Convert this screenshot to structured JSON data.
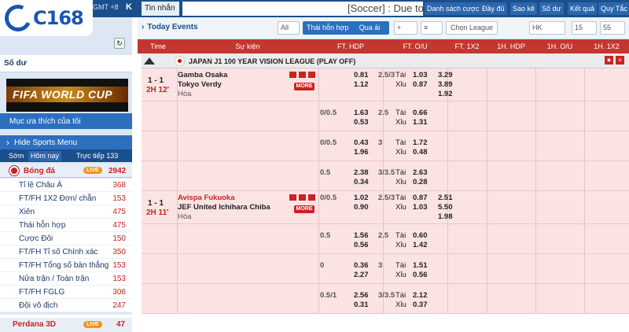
{
  "brand": {
    "name": "C168"
  },
  "topbar": {
    "gmt": "GMT +8",
    "k_label": "K",
    "msg_tab": "Tin nhắn",
    "ticker": "[Soccer] : Due to",
    "buttons": [
      "Danh sách cược",
      "Đầy đủ",
      "Sao kê",
      "Số dư",
      "Kết quả",
      "Quy Tắc"
    ]
  },
  "sidebar": {
    "balance_label": "Số dư",
    "banner_text": "FIFA WORLD CUP",
    "favorites": "Mục ưa thích của tôi",
    "hide_sports": "Hide Sports Menu",
    "tabs": [
      "Sớm",
      "Hôm nay",
      "Trực tiếp 133"
    ],
    "sport": {
      "name": "Bóng đá",
      "live": "LIVE",
      "count": "2942"
    },
    "menu": [
      {
        "label": "Tỉ lệ Châu Á",
        "count": "368"
      },
      {
        "label": "FT/FH 1X2 Đơn/ chẵn",
        "count": "153"
      },
      {
        "label": "Xiên",
        "count": "475"
      },
      {
        "label": "Thái hỗn hợp",
        "count": "475"
      },
      {
        "label": "Cược Đôi",
        "count": "150"
      },
      {
        "label": "FT/FH Tỉ số Chính xác",
        "count": "350"
      },
      {
        "label": "FT/FH Tổng số bàn thắng",
        "count": "153"
      },
      {
        "label": "Nửa trận / Toàn trận",
        "count": "153"
      },
      {
        "label": "FT/FH FGLG",
        "count": "306"
      },
      {
        "label": "Đội vô địch",
        "count": "247"
      }
    ],
    "next_sport": {
      "name": "Perdana 3D",
      "live": "LIVE",
      "count": "47"
    }
  },
  "main": {
    "title": "Today Events",
    "filters": {
      "all": "All",
      "mix": "Thái hỗn hợp",
      "qua_ai": "Qua ải",
      "plus": "+",
      "list": "≡",
      "choose_league": "Chọn League",
      "odds_type": "HK",
      "refresh_count": "15",
      "count2": "55"
    },
    "columns": [
      "Time",
      "Sự kiện",
      "FT. HDP",
      "FT. O/U",
      "FT. 1X2",
      "1H. HDP",
      "1H. O/U",
      "1H. 1X2"
    ],
    "league": "JAPAN J1 100 YEAR VISION LEAGUE (PLAY OFF)",
    "more_label": "MORE",
    "matches": [
      {
        "score": "1 - 1",
        "time": "2H 12'",
        "home": "Gamba Osaka",
        "away": "Tokyo Verdy",
        "draw": "Hòa",
        "home_color": "#222",
        "lines": [
          {
            "hdp_line": "",
            "hdp_h": "0.81",
            "hdp_a": "1.12",
            "ou_line": "2.5/3",
            "ou_over_lbl": "Tài",
            "ou_over": "1.03",
            "ou_under_lbl": "Xỉu",
            "ou_under": "0.87",
            "x1": "3.29",
            "x2": "3.89",
            "x3": "1.92"
          },
          {
            "hdp_line": "0/0.5",
            "hdp_h": "1.63",
            "hdp_a": "0.53",
            "ou_line": "2.5",
            "ou_over_lbl": "Tài",
            "ou_over": "0.66",
            "ou_under_lbl": "Xỉu",
            "ou_under": "1.31"
          },
          {
            "hdp_line": "0/0.5",
            "hdp_h": "0.43",
            "hdp_a": "1.96",
            "ou_line": "3",
            "ou_over_lbl": "Tài",
            "ou_over": "1.72",
            "ou_under_lbl": "Xỉu",
            "ou_under": "0.48"
          },
          {
            "hdp_line": "0.5",
            "hdp_h": "2.38",
            "hdp_a": "0.34",
            "ou_line": "3/3.5",
            "ou_over_lbl": "Tài",
            "ou_over": "2.63",
            "ou_under_lbl": "Xỉu",
            "ou_under": "0.28"
          }
        ]
      },
      {
        "score": "1 - 1",
        "time": "2H 11'",
        "home": "Avispa Fukuoka",
        "away": "JEF United Ichihara Chiba",
        "draw": "Hòa",
        "home_color": "#c22",
        "lines": [
          {
            "hdp_line": "0/0.5",
            "hdp_h": "1.02",
            "hdp_a": "0.90",
            "ou_line": "2.5/3",
            "ou_over_lbl": "Tài",
            "ou_over": "0.87",
            "ou_under_lbl": "Xỉu",
            "ou_under": "1.03",
            "x1": "2.51",
            "x2": "5.50",
            "x3": "1.98"
          },
          {
            "hdp_line": "0.5",
            "hdp_h": "1.56",
            "hdp_a": "0.56",
            "ou_line": "2.5",
            "ou_over_lbl": "Tài",
            "ou_over": "0.60",
            "ou_under_lbl": "Xỉu",
            "ou_under": "1.42"
          },
          {
            "hdp_line": "0",
            "hdp_h": "0.36",
            "hdp_a": "2.27",
            "ou_line": "3",
            "ou_over_lbl": "Tài",
            "ou_over": "1.51",
            "ou_under_lbl": "Xỉu",
            "ou_under": "0.56"
          },
          {
            "hdp_line": "0.5/1",
            "hdp_h": "2.56",
            "hdp_a": "0.31",
            "ou_line": "3/3.5",
            "ou_over_lbl": "Tài",
            "ou_over": "2.12",
            "ou_under_lbl": "Xỉu",
            "ou_under": "0.37"
          }
        ]
      }
    ]
  },
  "colors": {
    "header_blue": "#1b4f8c",
    "accent_red": "#c5362e",
    "row_pink": "#fbe3e3",
    "live_orange": "#f7931e"
  }
}
